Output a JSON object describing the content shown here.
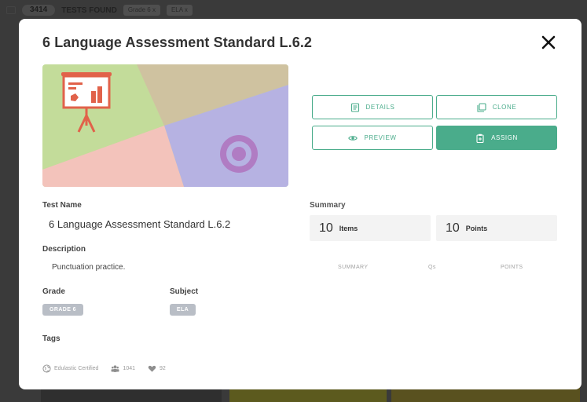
{
  "background": {
    "count_badge": "3414",
    "found_label": "TESTS FOUND",
    "filters": [
      "Grade 6 x",
      "ELA x"
    ]
  },
  "modal": {
    "title": "6 Language Assessment Standard L.6.2",
    "buttons": {
      "details": "DETAILS",
      "clone": "CLONE",
      "preview": "PREVIEW",
      "assign": "ASSIGN"
    },
    "test_name_label": "Test Name",
    "test_name": "6 Language Assessment Standard L.6.2",
    "description_label": "Description",
    "description": "Punctuation practice.",
    "grade_label": "Grade",
    "grade": "GRADE 6",
    "subject_label": "Subject",
    "subject": "ELA",
    "tags_label": "Tags",
    "summary_label": "Summary",
    "items_count": "10",
    "items_unit": "Items",
    "points_count": "10",
    "points_unit": "Points",
    "table_headers": [
      "SUMMARY",
      "Qs",
      "POINTS"
    ],
    "footer": {
      "certified": "Edulastic Certified",
      "usage_count": "1041",
      "likes_count": "92"
    }
  },
  "colors": {
    "accent": "#4aac8b",
    "tag_bg": "#b9bec6"
  }
}
